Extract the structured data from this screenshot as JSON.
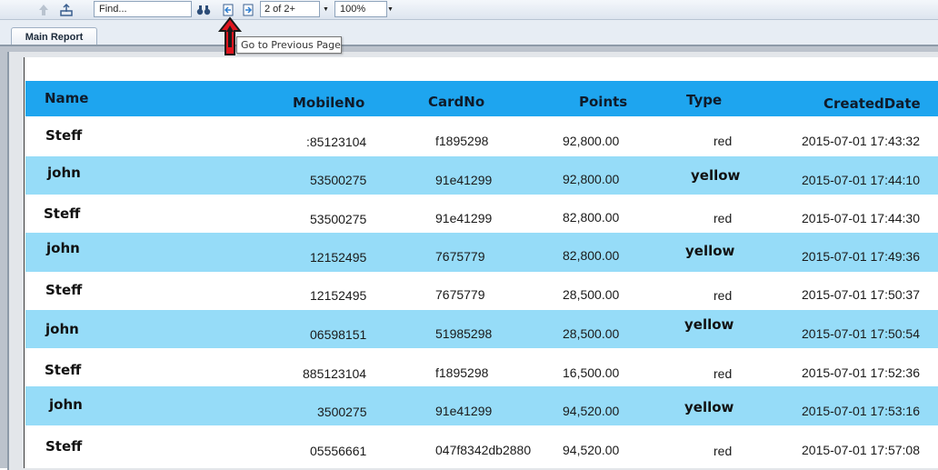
{
  "toolbar": {
    "find_placeholder": "Find...",
    "page_value": "2 of 2+",
    "zoom_value": "100%"
  },
  "tabs": [
    {
      "label": "Main Report"
    }
  ],
  "tooltip": {
    "text": "Go to Previous Page"
  },
  "colors": {
    "header_bg": "#1ea5ef",
    "alt_row_bg": "#96dcf8",
    "arrow": "#e0141e"
  },
  "table": {
    "headers": {
      "name": "Name",
      "mobile": "MobileNo",
      "card": "CardNo",
      "points": "Points",
      "type": "Type",
      "created": "CreatedDate"
    },
    "rows": [
      {
        "name": "Steff",
        "mobile": ":85123104",
        "card": "f1895298",
        "points": "92,800.00",
        "type": "red",
        "created": "2015-07-01  17:43:32"
      },
      {
        "name": "john",
        "mobile": "53500275",
        "card": "91e41299",
        "points": "92,800.00",
        "type": "yellow",
        "created": "2015-07-01  17:44:10"
      },
      {
        "name": "Steff",
        "mobile": "53500275",
        "card": "91e41299",
        "points": "82,800.00",
        "type": "red",
        "created": "2015-07-01  17:44:30"
      },
      {
        "name": "john",
        "mobile": "12152495",
        "card": "7675779",
        "points": "82,800.00",
        "type": "yellow",
        "created": "2015-07-01  17:49:36"
      },
      {
        "name": "Steff",
        "mobile": "12152495",
        "card": "7675779",
        "points": "28,500.00",
        "type": "red",
        "created": "2015-07-01  17:50:37"
      },
      {
        "name": "john",
        "mobile": "06598151",
        "card": "51985298",
        "points": "28,500.00",
        "type": "yellow",
        "created": "2015-07-01  17:50:54"
      },
      {
        "name": "Steff",
        "mobile": "885123104",
        "card": "f1895298",
        "points": "16,500.00",
        "type": "red",
        "created": "2015-07-01  17:52:36"
      },
      {
        "name": "john",
        "mobile": "3500275",
        "card": "91e41299",
        "points": "94,520.00",
        "type": "yellow",
        "created": "2015-07-01  17:53:16"
      },
      {
        "name": "Steff",
        "mobile": "05556661",
        "card": "047f8342db2880",
        "points": "94,520.00",
        "type": "red",
        "created": "2015-07-01  17:57:08"
      }
    ]
  }
}
